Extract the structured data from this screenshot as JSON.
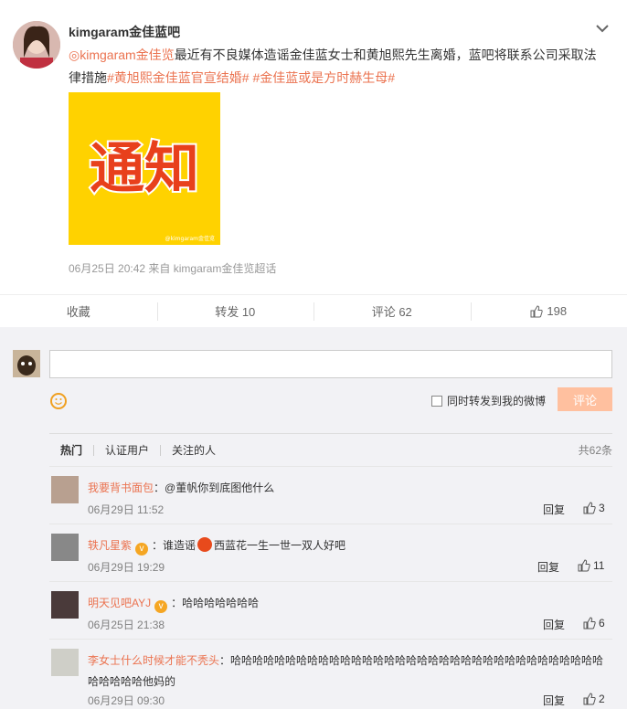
{
  "post": {
    "username": "kimgaram金佳蓝吧",
    "mention": "kimgaram金佳览",
    "body": "最近有不良媒体造谣金佳蓝女士和黄旭熙先生离婚，蓝吧将联系公司采取法律措施",
    "topic1": "#黄旭熙金佳蓝官宣结婚#",
    "topic2": "#金佳蓝或是方时赫生母#",
    "image_text": "通知",
    "image_watermark": "@kimgaram金佳览",
    "meta": "06月25日 20:42 来自 kimgaram金佳览超话"
  },
  "actions": {
    "collect": "收藏",
    "forward": "转发 10",
    "comment": "评论 62",
    "like": "198"
  },
  "composer": {
    "forward_label": "同时转发到我的微博",
    "send_label": "评论"
  },
  "filters": {
    "hot": "热门",
    "verified": "认证用户",
    "following": "关注的人",
    "total": "共62条"
  },
  "comments": [
    {
      "name": "我要背书面包",
      "text": "：@董帆你到底图他什么",
      "time": "06月29日 11:52",
      "reply": "回复",
      "likes": "3"
    },
    {
      "name": "轶凡星紫",
      "text_a": "：谁造谣",
      "text_b": "西蓝花一生一世一双人好吧",
      "time": "06月29日 19:29",
      "reply": "回复",
      "likes": "11"
    },
    {
      "name": "明天见吧AYJ",
      "text": "：哈哈哈哈哈哈哈",
      "time": "06月25日 21:38",
      "reply": "回复",
      "likes": "6"
    },
    {
      "name": "李女士什么时候才能不秃头",
      "text": "：哈哈哈哈哈哈哈哈哈哈哈哈哈哈哈哈哈哈哈哈哈哈哈哈哈哈哈哈哈哈哈哈哈哈哈哈哈哈哈他妈的",
      "time": "06月29日 09:30",
      "reply": "回复",
      "likes": "2"
    }
  ],
  "colors": {
    "accent": "#eb7350",
    "vip": "#f5a623",
    "image_bg": "#ffd200",
    "image_text": "#e8401c"
  }
}
